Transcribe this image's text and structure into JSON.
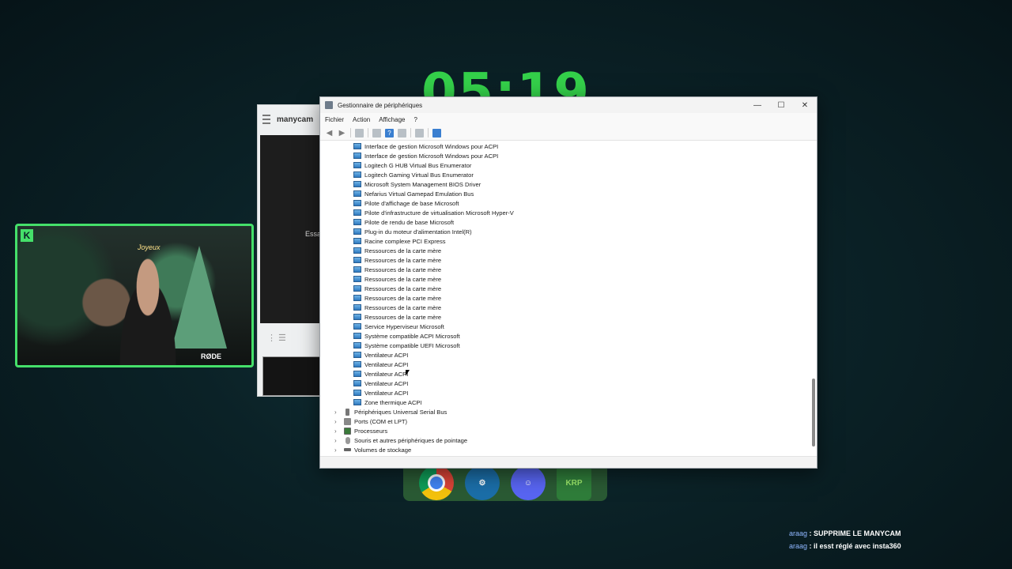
{
  "clock": "05:19",
  "manycam": {
    "logo": "manycam",
    "video_text": "Essa",
    "controls": "⋮ ☰"
  },
  "webcam": {
    "kick_logo": "K",
    "neon_sign": "Joyeux",
    "mic_brand": "RØDE"
  },
  "dock": {
    "apps": [
      "chrome-icon",
      "steam-icon",
      "discord-icon",
      "krp-icon"
    ],
    "krp_label": "KRP"
  },
  "chat": [
    {
      "user": "araag",
      "message": " : SUPPRIME LE MANYCAM"
    },
    {
      "user": "araag",
      "message": " : il esst réglé avec insta360"
    }
  ],
  "window": {
    "title": "Gestionnaire de périphériques",
    "controls": {
      "minimize": "—",
      "maximize": "☐",
      "close": "✕"
    },
    "menu": [
      "Fichier",
      "Action",
      "Affichage",
      "?"
    ]
  },
  "tree": {
    "children": [
      "Interface de gestion Microsoft Windows pour ACPI",
      "Interface de gestion Microsoft Windows pour ACPI",
      "Logitech G HUB Virtual Bus Enumerator",
      "Logitech Gaming Virtual Bus Enumerator",
      "Microsoft System Management BIOS Driver",
      "Nefarius Virtual Gamepad Emulation Bus",
      "Pilote d'affichage de base Microsoft",
      "Pilote d'infrastructure de virtualisation Microsoft Hyper-V",
      "Pilote de rendu de base Microsoft",
      "Plug-in du moteur d'alimentation Intel(R)",
      "Racine complexe PCI Express",
      "Ressources de la carte mère",
      "Ressources de la carte mère",
      "Ressources de la carte mère",
      "Ressources de la carte mère",
      "Ressources de la carte mère",
      "Ressources de la carte mère",
      "Ressources de la carte mère",
      "Ressources de la carte mère",
      "Service Hyperviseur Microsoft",
      "Système compatible ACPI Microsoft",
      "Système compatible UEFI Microsoft",
      "Ventilateur ACPI",
      "Ventilateur ACPI",
      "Ventilateur ACPI",
      "Ventilateur ACPI",
      "Ventilateur ACPI",
      "Zone thermique ACPI"
    ],
    "categories": [
      {
        "label": "Périphériques Universal Serial Bus",
        "icon": "usb-icon"
      },
      {
        "label": "Ports (COM et LPT)",
        "icon": "port-icon"
      },
      {
        "label": "Processeurs",
        "icon": "processor-icon"
      },
      {
        "label": "Souris et autres périphériques de pointage",
        "icon": "mouse-icon"
      },
      {
        "label": "Volumes de stockage",
        "icon": "disk-icon"
      }
    ]
  },
  "colors": {
    "accent_green": "#45e06a",
    "clock_green": "#34d04a",
    "device_icon_blue": "#2f7ac0"
  }
}
